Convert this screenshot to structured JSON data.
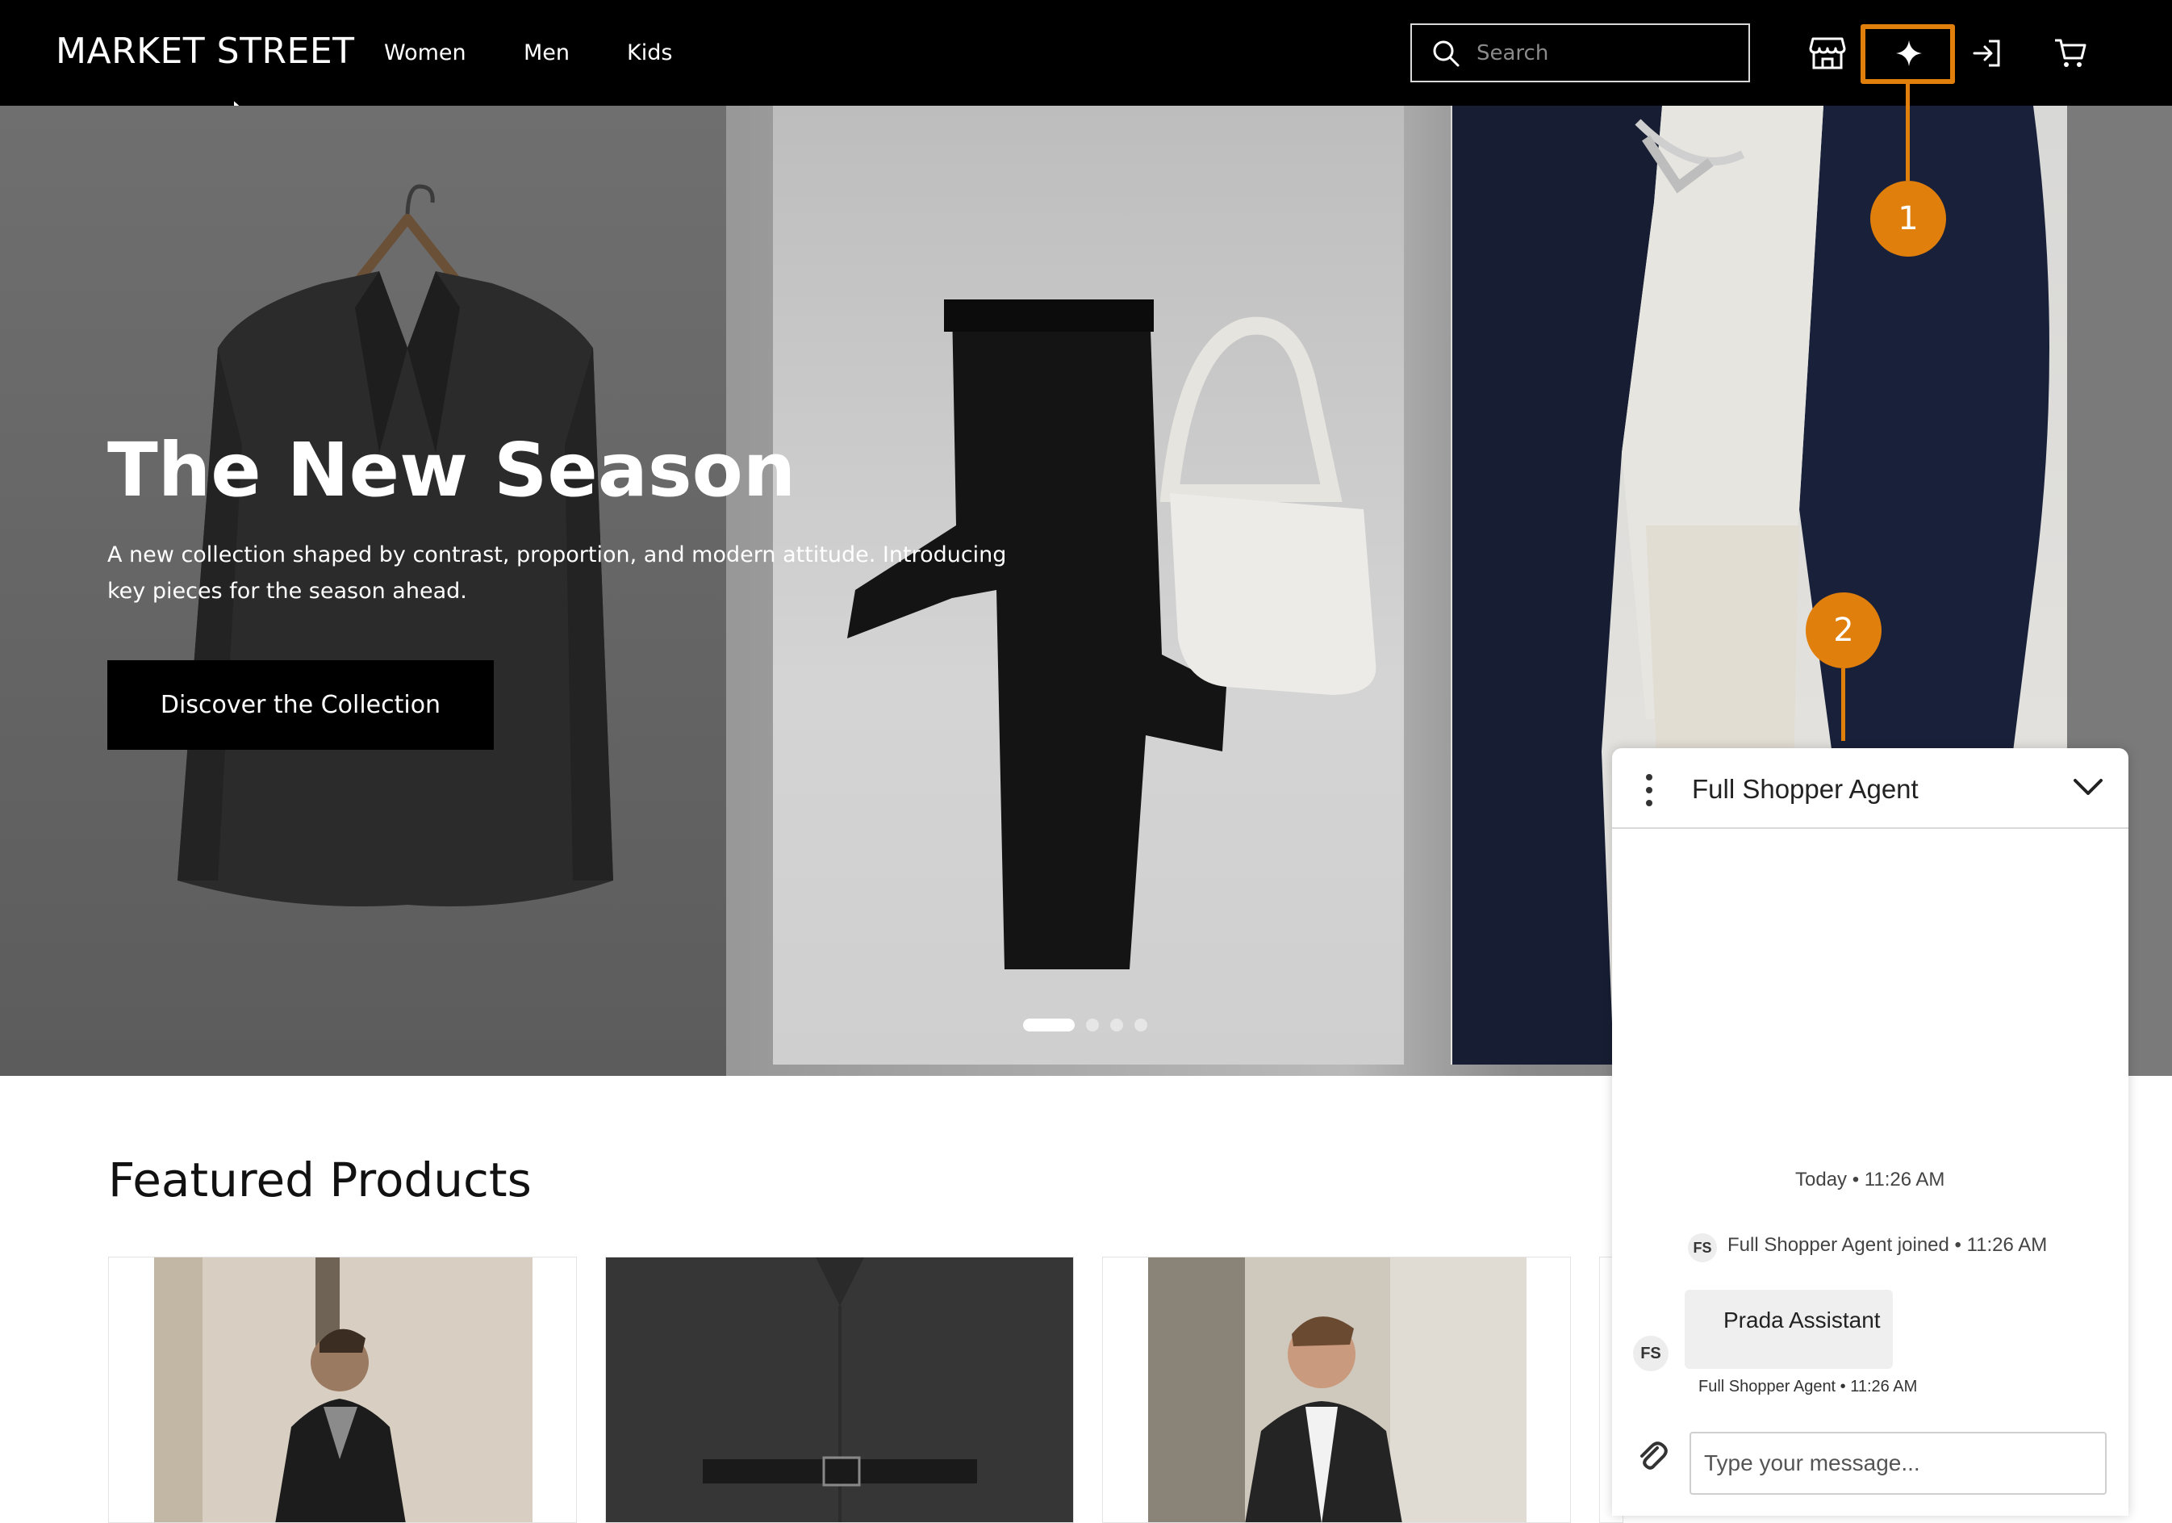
{
  "header": {
    "brand": "MARKET STREET",
    "nav": [
      "Women",
      "Men",
      "Kids"
    ],
    "search_placeholder": "Search",
    "icons": [
      "store-icon",
      "sparkle-icon",
      "sign-in-icon",
      "cart-icon"
    ]
  },
  "hero": {
    "title": "The New Season",
    "subtitle": "A new collection shaped by contrast, proportion, and modern attitude. Introducing key pieces for the season ahead.",
    "cta": "Discover the Collection",
    "slides": 4,
    "active_slide": 1
  },
  "featured": {
    "title": "Featured Products"
  },
  "callouts": [
    "1",
    "2"
  ],
  "chat": {
    "title": "Full Shopper Agent",
    "date_line": "Today • 11:26 AM",
    "join_badge": "FS",
    "join_line": "Full Shopper Agent joined • 11:26 AM",
    "message_badge": "FS",
    "message": "Prada Assistant",
    "message_meta": "Full Shopper Agent • 11:26 AM",
    "input_placeholder": "Type your message..."
  },
  "colors": {
    "accent": "#e07f0b",
    "header_bg": "#000000"
  }
}
